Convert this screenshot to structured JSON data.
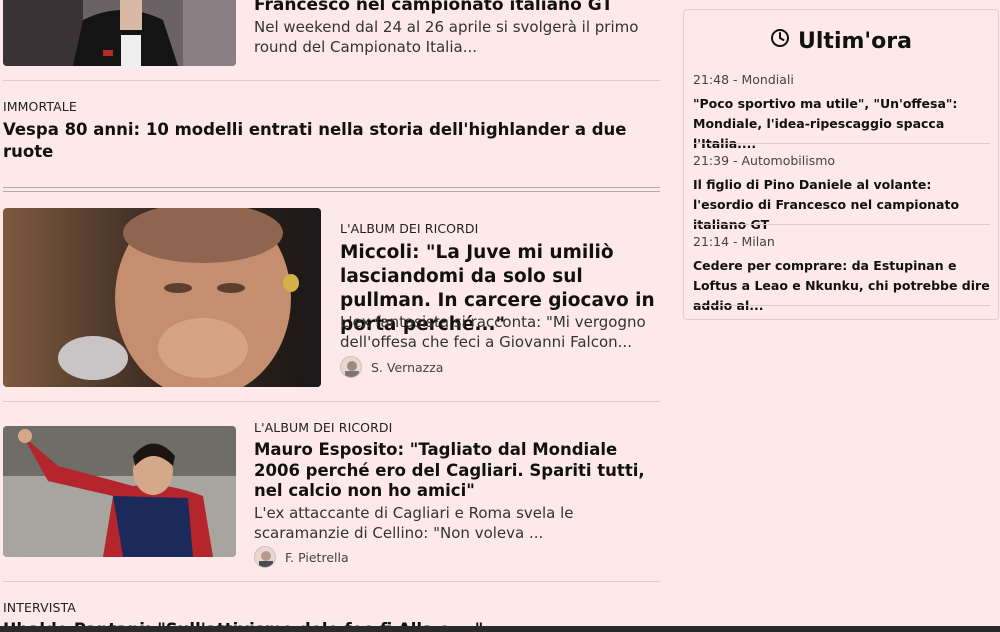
{
  "articles": [
    {
      "title_partial": "Francesco nel campionato italiano GT",
      "summary": "Nel weekend dal 24 al 26 aprile si svolgerà il primo round del Campionato Italia..."
    },
    {
      "kicker": "IMMORTALE",
      "title": "Vespa 80 anni: 10 modelli entrati nella storia dell'highlander a due ruote"
    },
    {
      "kicker": "L'ALBUM DEI RICORDI",
      "title": "Miccoli: \"La Juve mi umiliò lasciandomi da solo sul pullman. In carcere giocavo in porta perché...\"",
      "summary": "L'ex fantasista si racconta: \"Mi vergogno dell'offesa che feci a Giovanni Falcon...",
      "author": "S. Vernazza"
    },
    {
      "kicker": "L'ALBUM DEI RICORDI",
      "title": "Mauro Esposito: \"Tagliato dal Mondiale 2006 perché ero del Cagliari. Spariti tutti, nel calcio non ho amici\"",
      "summary": "L'ex attaccante di Cagliari e Roma svela le scaramanzie di Cellino: \"Non voleva ...",
      "author": "F. Pietrella"
    },
    {
      "kicker": "INTERVISTA",
      "title_partial": "Ubaldo Pantani: \"Sull'attivismo dele foo fi Alla e ...\""
    }
  ],
  "sidebar": {
    "title": "Ultim'ora",
    "items": [
      {
        "time": "21:48",
        "category": "Mondiali",
        "text": "\"Poco sportivo ma utile\", \"Un'offesa\": Mondiale, l'idea-ripescaggio spacca l'Italia...."
      },
      {
        "time": "21:39",
        "category": "Automobilismo",
        "text": "Il figlio di Pino Daniele al volante: l'esordio di Francesco nel campionato italiano GT"
      },
      {
        "time": "21:14",
        "category": "Milan",
        "text": "Cedere per comprare: da Estupinan e Loftus a Leao e Nkunku, chi potrebbe dire addio al..."
      }
    ]
  },
  "icons": {
    "clock": "clock-icon"
  },
  "colors": {
    "background": "#fde8ea",
    "divider": "#e2c9cc",
    "text": "#111111"
  }
}
